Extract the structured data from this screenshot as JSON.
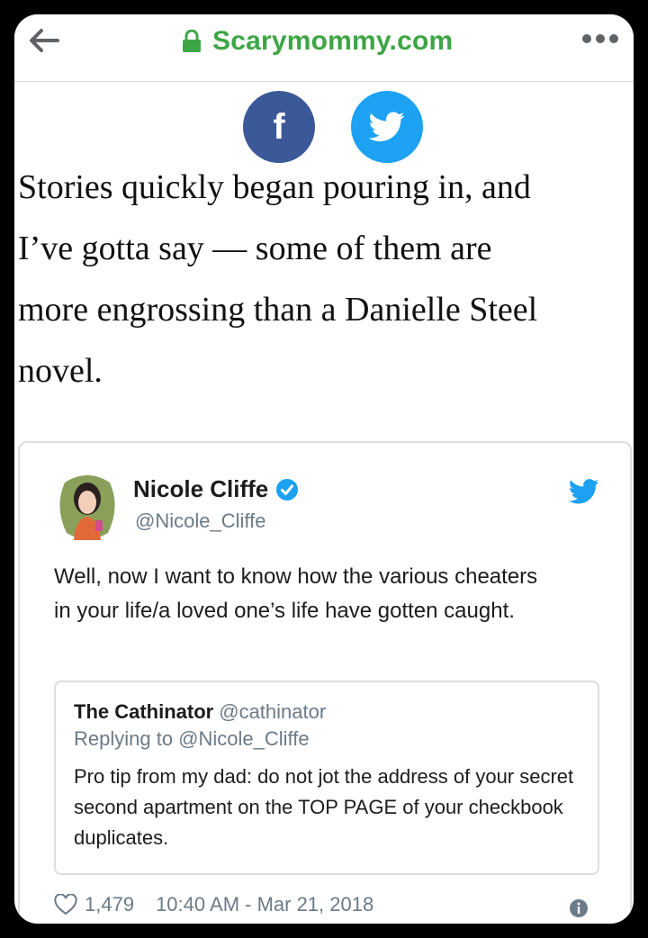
{
  "browser": {
    "url": "Scarymommy.com",
    "colors": {
      "url_green": "#3ea545",
      "facebook": "#3b5998",
      "twitter": "#1da1f2"
    }
  },
  "article": {
    "lines": [
      "Stories quickly began pouring in, and",
      "I’ve gotta say — some of them are",
      "more engrossing than a Danielle Steel",
      "novel."
    ]
  },
  "share": {
    "facebook_glyph": "f"
  },
  "tweet": {
    "name": "Nicole Cliffe",
    "handle": "@Nicole_Cliffe",
    "text": "Well, now I want to know how the various cheaters in your life/a loved one’s life have gotten caught.",
    "quote": {
      "name": "The Cathinator",
      "handle": "@cathinator",
      "replying": "Replying to @Nicole_Cliffe",
      "text": "Pro tip from my dad: do not jot the address of your secret second apartment on the TOP PAGE of your checkbook duplicates."
    },
    "likes": "1,479",
    "timestamp": "10:40 AM - Mar 21, 2018"
  }
}
